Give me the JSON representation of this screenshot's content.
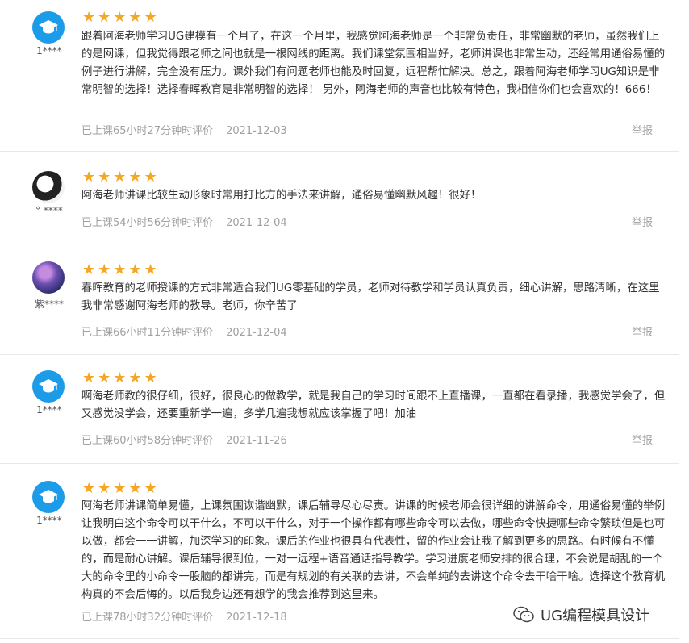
{
  "reviews": [
    {
      "user": "1****",
      "avatar": "graduation-cap-avatar",
      "stars": "★★★★★",
      "text": "跟着阿海老师学习UG建模有一个月了，在这一个月里，我感觉阿海老师是一个非常负责任，非常幽默的老师，虽然我们上的是网课，但我觉得跟老师之间也就是一根网线的距离。我们课堂氛围相当好，老师讲课也非常生动，还经常用通俗易懂的例子进行讲解，完全没有压力。课外我们有问题老师也能及时回复，远程帮忙解决。总之，跟着阿海老师学习UG知识是非常明智的选择！选择春晖教育是非常明智的选择！ 另外，阿海老师的声音也比较有特色，我相信你们也会喜欢的！666！",
      "duration": "已上课65小时27分钟时评价",
      "date": "2021-12-03",
      "report": "举报"
    },
    {
      "user": "° ****",
      "avatar": "cartoon-avatar",
      "stars": "★★★★★",
      "text": "阿海老师讲课比较生动形象时常用打比方的手法来讲解，通俗易懂幽默风趣！很好！",
      "duration": "已上课54小时56分钟时评价",
      "date": "2021-12-04",
      "report": "举报"
    },
    {
      "user": "紫****",
      "avatar": "galaxy-avatar",
      "stars": "★★★★★",
      "text": "春晖教育的老师授课的方式非常适合我们UG零基础的学员，老师对待教学和学员认真负责，细心讲解，思路清晰，在这里我非常感谢阿海老师的教导。老师，你辛苦了",
      "duration": "已上课66小时11分钟时评价",
      "date": "2021-12-04",
      "report": "举报"
    },
    {
      "user": "1****",
      "avatar": "graduation-cap-avatar",
      "stars": "★★★★★",
      "text": "啊海老师教的很仔细，很好，很良心的做教学，就是我自己的学习时间跟不上直播课，一直都在看录播，我感觉学会了，但又感觉没学会，还要重新学一遍，多学几遍我想就应该掌握了吧！加油",
      "duration": "已上课60小时58分钟时评价",
      "date": "2021-11-26",
      "report": "举报"
    },
    {
      "user": "1****",
      "avatar": "graduation-cap-avatar",
      "stars": "★★★★★",
      "text": " 阿海老师讲课简单易懂，上课氛围诙谐幽默，课后辅导尽心尽责。讲课的时候老师会很详细的讲解命令，用通俗易懂的举例让我明白这个命令可以干什么，不可以干什么，对于一个操作都有哪些命令可以去做，哪些命令快捷哪些命令繁琐但是也可以做，都会一一讲解，加深学习的印象。课后的作业也很具有代表性，留的作业会让我了解到更多的思路。有时候有不懂的，而是耐心讲解。课后辅导很到位，一对一远程+语音通话指导教学。学习进度老师安排的很合理，不会说是胡乱的一个大的命令里的小命令一股脑的都讲完，而是有规划的有关联的去讲，不会单纯的去讲这个命令去干啥干啥。选择这个教育机构真的不会后悔的。以后我身边还有想学的我会推荐到这里来。",
      "duration": "已上课78小时32分钟时评价",
      "date": "2021-12-18",
      "report": "举报"
    }
  ],
  "watermark": {
    "text": "UG编程模具设计",
    "icon": "wechat-icon"
  }
}
